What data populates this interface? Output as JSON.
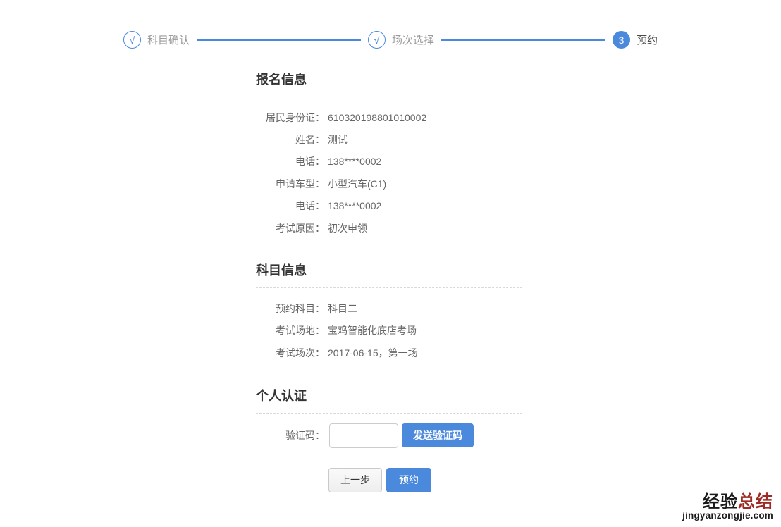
{
  "colors": {
    "accent_blue": "#4a89dc",
    "watermark_red": "#9e2b23"
  },
  "stepper": {
    "steps": [
      {
        "icon": "√",
        "label": "科目确认",
        "state": "done"
      },
      {
        "icon": "√",
        "label": "场次选择",
        "state": "done"
      },
      {
        "icon": "3",
        "label": "预约",
        "state": "active"
      }
    ]
  },
  "sections": {
    "registration": {
      "title": "报名信息",
      "fields": [
        {
          "label": "居民身份证：",
          "value": "610320198801010002"
        },
        {
          "label": "姓名：",
          "value": "测试"
        },
        {
          "label": "电话：",
          "value": "138****0002"
        },
        {
          "label": "申请车型：",
          "value": "小型汽车(C1)"
        },
        {
          "label": "电话：",
          "value": "138****0002"
        },
        {
          "label": "考试原因：",
          "value": "初次申领"
        }
      ]
    },
    "subject": {
      "title": "科目信息",
      "fields": [
        {
          "label": "预约科目：",
          "value": "科目二"
        },
        {
          "label": "考试场地：",
          "value": "宝鸡智能化底店考场"
        },
        {
          "label": "考试场次：",
          "value": "2017-06-15，第一场"
        }
      ]
    },
    "verification": {
      "title": "个人认证",
      "code_label": "验证码：",
      "code_value": "",
      "send_button": "发送验证码"
    }
  },
  "actions": {
    "prev": "上一步",
    "submit": "预约"
  },
  "watermark": {
    "cn_black": "经验",
    "cn_red": "总结",
    "site": "jingyanzongjie.com"
  }
}
